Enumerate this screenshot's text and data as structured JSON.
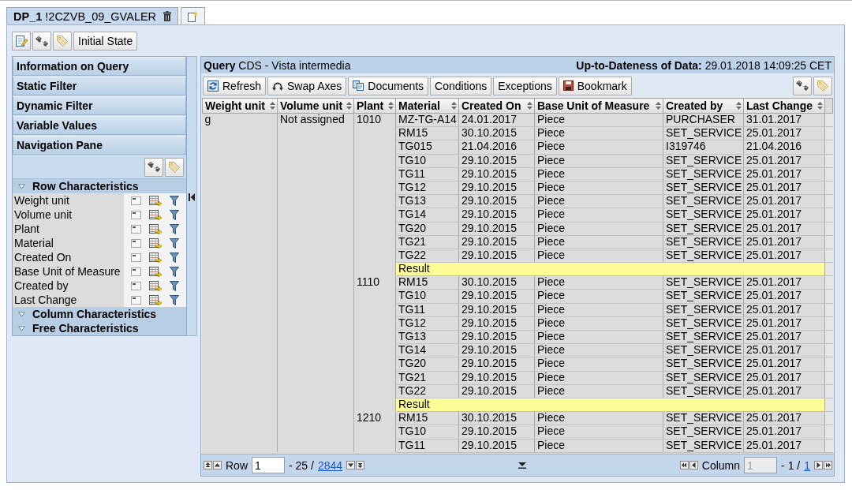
{
  "tabs": [
    {
      "kind": "document",
      "label": "**DP_1** !2CZVB_09_GVALER",
      "selected": true
    },
    {
      "kind": "new",
      "selected": false
    }
  ],
  "toolbar": [
    {
      "kind": "edit"
    },
    {
      "kind": "settings"
    },
    {
      "kind": "tag"
    },
    {
      "kind": "text",
      "label": "Initial State"
    }
  ],
  "sidebar": {
    "sections": [
      "Information on Query",
      "Static Filter",
      "Dynamic Filter",
      "Variable Values",
      "Navigation Pane"
    ],
    "tools": [
      {
        "kind": "settings"
      },
      {
        "kind": "tag"
      }
    ],
    "groups": [
      {
        "label": "Row Characteristics",
        "expanded": true,
        "items": [
          "Weight unit",
          "Volume unit",
          "Plant",
          "Material",
          "Created On",
          "Base Unit of Measure",
          "Created by",
          "Last Change"
        ]
      },
      {
        "label": "Column Characteristics",
        "expanded": true
      },
      {
        "label": "Free Characteristics",
        "expanded": true
      }
    ]
  },
  "query": {
    "title": "**Query** CDS - Vista intermedia",
    "freshness": "**Up-to-Dateness of Data:** 29.01.2018 14:09:25 CET",
    "toolbar": [
      {
        "kind": "refresh",
        "label": "Refresh"
      },
      {
        "kind": "swap",
        "label": "Swap Axes"
      },
      {
        "kind": "documents",
        "label": "Documents"
      },
      {
        "kind": "text",
        "label": "Conditions"
      },
      {
        "kind": "text",
        "label": "Exceptions"
      },
      {
        "kind": "bookmark",
        "label": "Bookmark"
      }
    ],
    "tools": [
      {
        "kind": "settings"
      },
      {
        "kind": "tag"
      }
    ],
    "table": {
      "columns": [
        "Weight unit",
        "Volume unit",
        "Plant",
        "Material",
        "Created On",
        "Base Unit of Measure",
        "Created by",
        "Last Change"
      ],
      "weight_unit": "g",
      "volume_unit": "Not assigned",
      "plants": [
        {
          "plant": "1010",
          "rows": [
            {
              "kind": "data",
              "cells": [
                "MZ-TG-A14",
                "24.01.2017",
                "Piece",
                "PURCHASER",
                "31.01.2017"
              ]
            },
            {
              "kind": "data",
              "cells": [
                "RM15",
                "30.10.2015",
                "Piece",
                "SET_SERVICE",
                "25.01.2017"
              ]
            },
            {
              "kind": "data",
              "cells": [
                "TG015",
                "21.04.2016",
                "Piece",
                "I319746",
                "21.04.2016"
              ]
            },
            {
              "kind": "data",
              "cells": [
                "TG10",
                "29.10.2015",
                "Piece",
                "SET_SERVICE",
                "25.01.2017"
              ]
            },
            {
              "kind": "data",
              "cells": [
                "TG11",
                "29.10.2015",
                "Piece",
                "SET_SERVICE",
                "25.01.2017"
              ]
            },
            {
              "kind": "data",
              "cells": [
                "TG12",
                "29.10.2015",
                "Piece",
                "SET_SERVICE",
                "25.01.2017"
              ]
            },
            {
              "kind": "data",
              "cells": [
                "TG13",
                "29.10.2015",
                "Piece",
                "SET_SERVICE",
                "25.01.2017"
              ]
            },
            {
              "kind": "data",
              "cells": [
                "TG14",
                "29.10.2015",
                "Piece",
                "SET_SERVICE",
                "25.01.2017"
              ]
            },
            {
              "kind": "data",
              "cells": [
                "TG20",
                "29.10.2015",
                "Piece",
                "SET_SERVICE",
                "25.01.2017"
              ]
            },
            {
              "kind": "data",
              "cells": [
                "TG21",
                "29.10.2015",
                "Piece",
                "SET_SERVICE",
                "25.01.2017"
              ]
            },
            {
              "kind": "data",
              "cells": [
                "TG22",
                "29.10.2015",
                "Piece",
                "SET_SERVICE",
                "25.01.2017"
              ]
            },
            {
              "kind": "result",
              "label": "Result"
            }
          ]
        },
        {
          "plant": "1110",
          "rows": [
            {
              "kind": "data",
              "cells": [
                "RM15",
                "30.10.2015",
                "Piece",
                "SET_SERVICE",
                "25.01.2017"
              ]
            },
            {
              "kind": "data",
              "cells": [
                "TG10",
                "29.10.2015",
                "Piece",
                "SET_SERVICE",
                "25.01.2017"
              ]
            },
            {
              "kind": "data",
              "cells": [
                "TG11",
                "29.10.2015",
                "Piece",
                "SET_SERVICE",
                "25.01.2017"
              ]
            },
            {
              "kind": "data",
              "cells": [
                "TG12",
                "29.10.2015",
                "Piece",
                "SET_SERVICE",
                "25.01.2017"
              ]
            },
            {
              "kind": "data",
              "cells": [
                "TG13",
                "29.10.2015",
                "Piece",
                "SET_SERVICE",
                "25.01.2017"
              ]
            },
            {
              "kind": "data",
              "cells": [
                "TG14",
                "29.10.2015",
                "Piece",
                "SET_SERVICE",
                "25.01.2017"
              ]
            },
            {
              "kind": "data",
              "cells": [
                "TG20",
                "29.10.2015",
                "Piece",
                "SET_SERVICE",
                "25.01.2017"
              ]
            },
            {
              "kind": "data",
              "cells": [
                "TG21",
                "29.10.2015",
                "Piece",
                "SET_SERVICE",
                "25.01.2017"
              ]
            },
            {
              "kind": "data",
              "cells": [
                "TG22",
                "29.10.2015",
                "Piece",
                "SET_SERVICE",
                "25.01.2017"
              ]
            },
            {
              "kind": "result",
              "label": "Result"
            }
          ]
        },
        {
          "plant": "1210",
          "rows": [
            {
              "kind": "data",
              "cells": [
                "RM15",
                "30.10.2015",
                "Piece",
                "SET_SERVICE",
                "25.01.2017"
              ]
            },
            {
              "kind": "data",
              "cells": [
                "TG10",
                "29.10.2015",
                "Piece",
                "SET_SERVICE",
                "25.01.2017"
              ]
            },
            {
              "kind": "data",
              "cells": [
                "TG11",
                "29.10.2015",
                "Piece",
                "SET_SERVICE",
                "25.01.2017"
              ]
            }
          ]
        }
      ]
    },
    "pager": {
      "row_label": "Row",
      "row_field": {
        "value": "1",
        "disabled": false
      },
      "row_range": "- 25 /",
      "row_total": "2844",
      "column_label": "Column",
      "column_field": {
        "value": "1",
        "disabled": true
      },
      "column_range": "- 1 /",
      "column_total": "1"
    }
  }
}
